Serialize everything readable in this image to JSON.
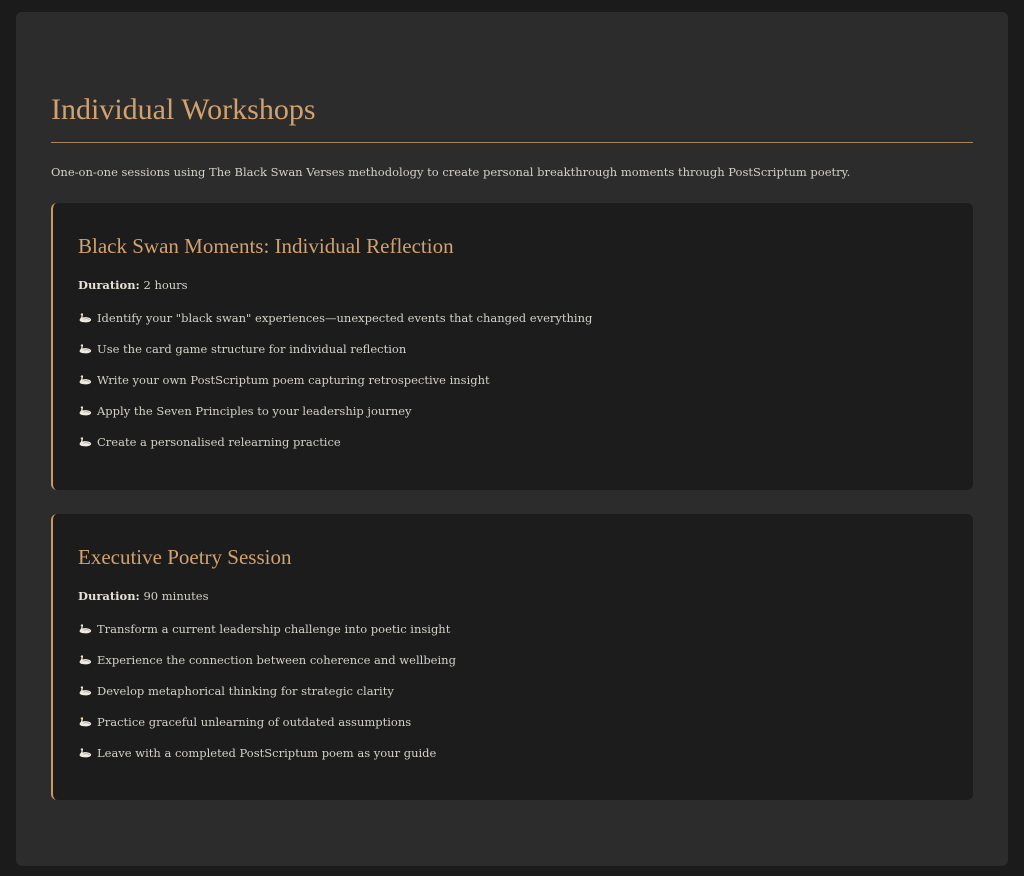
{
  "page": {
    "title": "Individual Workshops",
    "intro": "One-on-one sessions using The Black Swan Verses methodology to create personal breakthrough moments through PostScriptum poetry."
  },
  "colors": {
    "background": "#1b1b1b",
    "panel": "#2c2c2c",
    "card": "#1c1c1c",
    "accent": "#d1a16e"
  },
  "bullet_icon": "swan-icon",
  "workshops": [
    {
      "title": "Black Swan Moments: Individual Reflection",
      "duration_label": "Duration:",
      "duration": "2 hours",
      "items": [
        "Identify your \"black swan\" experiences—unexpected events that changed everything",
        "Use the card game structure for individual reflection",
        "Write your own PostScriptum poem capturing retrospective insight",
        "Apply the Seven Principles to your leadership journey",
        "Create a personalised relearning practice"
      ]
    },
    {
      "title": "Executive Poetry Session",
      "duration_label": "Duration:",
      "duration": "90 minutes",
      "items": [
        "Transform a current leadership challenge into poetic insight",
        "Experience the connection between coherence and wellbeing",
        "Develop metaphorical thinking for strategic clarity",
        "Practice graceful unlearning of outdated assumptions",
        "Leave with a completed PostScriptum poem as your guide"
      ]
    }
  ]
}
